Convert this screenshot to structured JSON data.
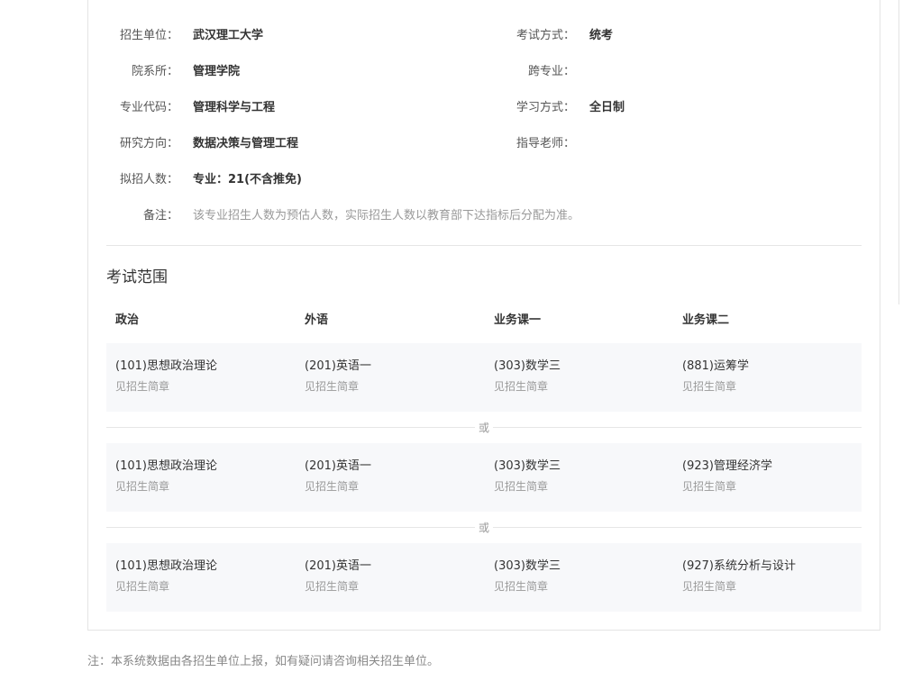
{
  "info": {
    "unit_label": "招生单位：",
    "unit_value": "武汉理工大学",
    "exam_mode_label": "考试方式：",
    "exam_mode_value": "统考",
    "dept_label": "院系所：",
    "dept_value": "管理学院",
    "cross_major_label": "跨专业：",
    "cross_major_value": "",
    "major_label": "专业代码：",
    "major_value": "管理科学与工程",
    "study_mode_label": "学习方式：",
    "study_mode_value": "全日制",
    "direction_label": "研究方向：",
    "direction_value": "数据决策与管理工程",
    "advisor_label": "指导老师：",
    "advisor_value": "",
    "quota_label": "拟招人数：",
    "quota_value": "专业：21(不含推免)",
    "remark_label": "备注：",
    "remark_value": "该专业招生人数为预估人数，实际招生人数以教育部下达指标后分配为准。"
  },
  "exam_scope": {
    "title": "考试范围",
    "columns": [
      "政治",
      "外语",
      "业务课一",
      "业务课二"
    ],
    "separator": "或",
    "options": [
      {
        "cells": [
          {
            "course": "(101)思想政治理论",
            "note": "见招生简章"
          },
          {
            "course": "(201)英语一",
            "note": "见招生简章"
          },
          {
            "course": "(303)数学三",
            "note": "见招生简章"
          },
          {
            "course": "(881)运筹学",
            "note": "见招生简章"
          }
        ]
      },
      {
        "cells": [
          {
            "course": "(101)思想政治理论",
            "note": "见招生简章"
          },
          {
            "course": "(201)英语一",
            "note": "见招生简章"
          },
          {
            "course": "(303)数学三",
            "note": "见招生简章"
          },
          {
            "course": "(923)管理经济学",
            "note": "见招生简章"
          }
        ]
      },
      {
        "cells": [
          {
            "course": "(101)思想政治理论",
            "note": "见招生简章"
          },
          {
            "course": "(201)英语一",
            "note": "见招生简章"
          },
          {
            "course": "(303)数学三",
            "note": "见招生简章"
          },
          {
            "course": "(927)系统分析与设计",
            "note": "见招生简章"
          }
        ]
      }
    ]
  },
  "footer": {
    "note": "注：本系统数据由各招生单位上报，如有疑问请咨询相关招生单位。"
  }
}
